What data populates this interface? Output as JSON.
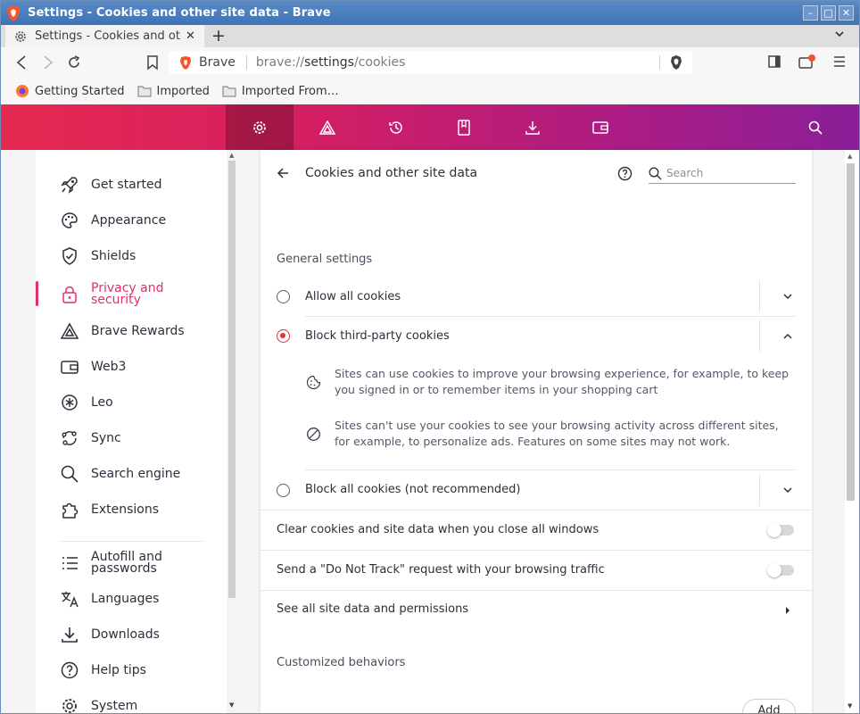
{
  "window": {
    "title": "Settings - Cookies and other site data - Brave",
    "controls": [
      "minimize",
      "maximize",
      "close"
    ]
  },
  "tab": {
    "label": "Settings - Cookies and othe",
    "new_tab_symbol": "+"
  },
  "address_bar": {
    "brand": "Brave",
    "url_scheme": "brave://",
    "url_host": "settings",
    "url_path": "/cookies"
  },
  "bookmarks": [
    {
      "label": "Getting Started",
      "icon": "firefox-icon"
    },
    {
      "label": "Imported",
      "icon": "folder-icon"
    },
    {
      "label": "Imported From…",
      "icon": "folder-icon"
    }
  ],
  "sidebar": {
    "items": [
      {
        "label": "Get started",
        "icon": "rocket-icon"
      },
      {
        "label": "Appearance",
        "icon": "palette-icon"
      },
      {
        "label": "Shields",
        "icon": "shield-icon"
      },
      {
        "label": "Privacy and security",
        "icon": "lock-icon",
        "active": true
      },
      {
        "label": "Brave Rewards",
        "icon": "rewards-triangle-icon"
      },
      {
        "label": "Web3",
        "icon": "wallet-icon"
      },
      {
        "label": "Leo",
        "icon": "leo-icon"
      },
      {
        "label": "Sync",
        "icon": "sync-icon"
      },
      {
        "label": "Search engine",
        "icon": "search-icon"
      },
      {
        "label": "Extensions",
        "icon": "puzzle-icon"
      },
      {
        "label": "Autofill and passwords",
        "icon": "list-icon"
      },
      {
        "label": "Languages",
        "icon": "translate-icon"
      },
      {
        "label": "Downloads",
        "icon": "download-icon"
      },
      {
        "label": "Help tips",
        "icon": "help-icon"
      },
      {
        "label": "System",
        "icon": "gear-icon"
      }
    ]
  },
  "main": {
    "title": "Cookies and other site data",
    "search_placeholder": "Search",
    "general_settings": "General settings",
    "options": [
      {
        "label": "Allow all cookies",
        "selected": false,
        "expanded": false
      },
      {
        "label": "Block third-party cookies",
        "selected": true,
        "expanded": true
      },
      {
        "label": "Block all cookies (not recommended)",
        "selected": false,
        "expanded": false
      }
    ],
    "details": [
      "Sites can use cookies to improve your browsing experience, for example, to keep you signed in or to remember items in your shopping cart",
      "Sites can't use your cookies to see your browsing activity across different sites, for example, to personalize ads. Features on some sites may not work."
    ],
    "clear_on_exit": {
      "label": "Clear cookies and site data when you close all windows",
      "on": false
    },
    "do_not_track": {
      "label": "Send a \"Do Not Track\" request with your browsing traffic",
      "on": false
    },
    "see_all": "See all site data and permissions",
    "customized_behaviors": "Customized behaviors",
    "add_button": "Add"
  },
  "colors": {
    "accent": "#e0306a",
    "radio_selected": "#e0313d",
    "band_start": "#e6294f",
    "band_end": "#8a1f98"
  }
}
